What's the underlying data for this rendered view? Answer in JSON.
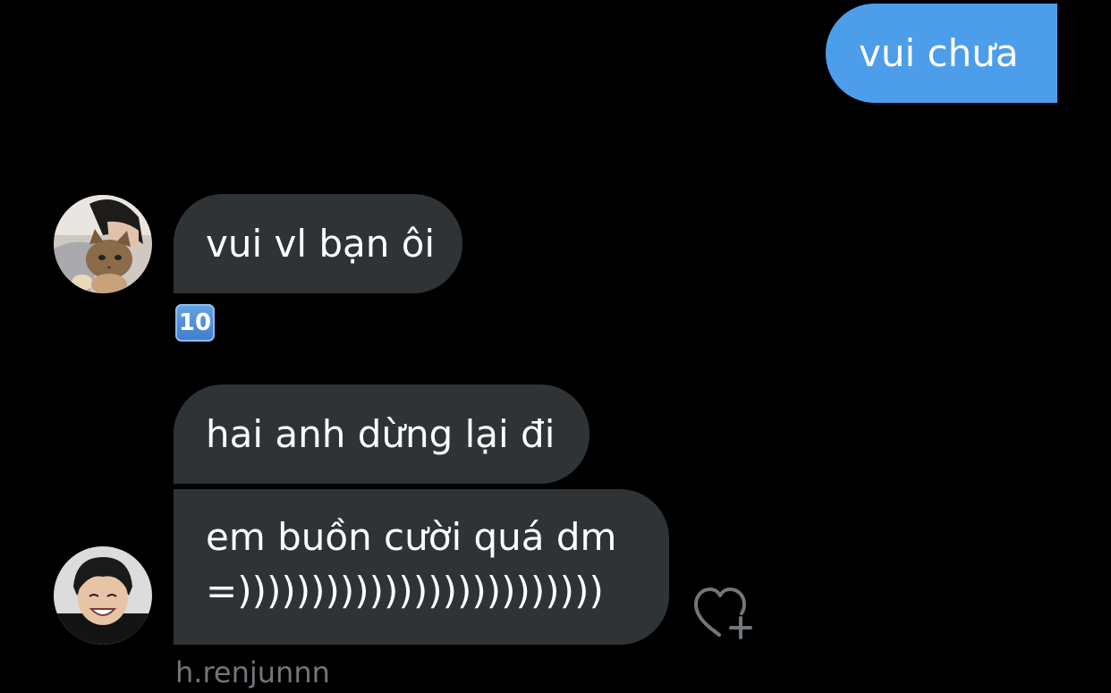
{
  "messages": {
    "outgoing_1": "vui chưa",
    "incoming_1": "vui vl bạn ôi",
    "incoming_2": "hai anh dừng lại đi",
    "incoming_3_line1": "em buồn cười quá dm",
    "incoming_3_line2": "=)))))))))))))))))))))))))"
  },
  "reaction": {
    "emoji": "10",
    "emoji_name": "keycap-ten"
  },
  "sender": {
    "username": "h.renjunnn"
  },
  "icons": {
    "like": "heart-plus-icon"
  },
  "colors": {
    "background": "#000000",
    "outgoing_bubble": "#4c9eeb",
    "incoming_bubble": "#2f3336",
    "muted_text": "#71767b"
  }
}
